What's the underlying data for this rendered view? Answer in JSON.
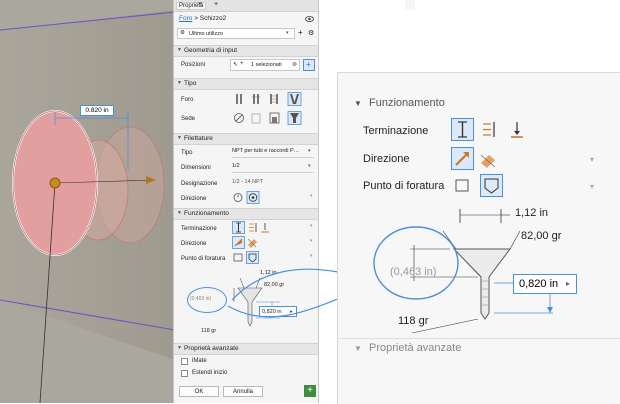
{
  "viewport": {
    "dimension_label": "0.820 in"
  },
  "panel": {
    "title": "Proprietà",
    "tab_add": "+",
    "close": "×",
    "breadcrumb": {
      "feature": "Foro",
      "sketch": "Schizzo2",
      "sep": ">"
    },
    "preset": {
      "value": "Ultimo utilizzo"
    },
    "geometry": {
      "title": "Geometria di input",
      "positions_label": "Posizioni",
      "positions_value": "1 selezionati"
    },
    "tipo": {
      "title": "Tipo",
      "foro_label": "Foro",
      "sede_label": "Sede"
    },
    "filettature": {
      "title": "Filettature",
      "tipo_label": "Tipo",
      "tipo_value": "NPT per tubi e raccordi P…",
      "dimensioni_label": "Dimensioni",
      "dimensioni_value": "1/2",
      "designazione_label": "Designazione",
      "designazione_value": "1/2 - 14 NPT",
      "direzione_label": "Direzione"
    },
    "funzionamento": {
      "title": "Funzionamento",
      "terminazione_label": "Terminazione",
      "direzione_label": "Direzione",
      "punto_label": "Punto di foratura"
    },
    "diagram": {
      "d1": "1,12 in",
      "d2": "82,00 gr",
      "d3": "(0,463 in)",
      "d4": "0,820 in",
      "d5": "118 gr"
    },
    "advanced": {
      "title": "Proprietà avanzate",
      "imate": "iMate",
      "estendi": "Estendi inizio"
    },
    "footer": {
      "ok": "OK",
      "cancel": "Annulla",
      "add": "+"
    }
  },
  "zoom": {
    "funzionamento_title": "Funzionamento",
    "terminazione_label": "Terminazione",
    "direzione_label": "Direzione",
    "punto_label": "Punto di foratura",
    "d1": "1,12 in",
    "d2": "82,00 gr",
    "d3": "(0,463 in)",
    "d4": "0,820 in",
    "d5": "118 gr",
    "advanced_title": "Proprietà avanzate"
  },
  "colors": {
    "accent": "#4a90d9",
    "viewport_bg": "#a6a39a",
    "hole_fill": "#e8a0a0",
    "preview_arrow": "#b0762a"
  }
}
